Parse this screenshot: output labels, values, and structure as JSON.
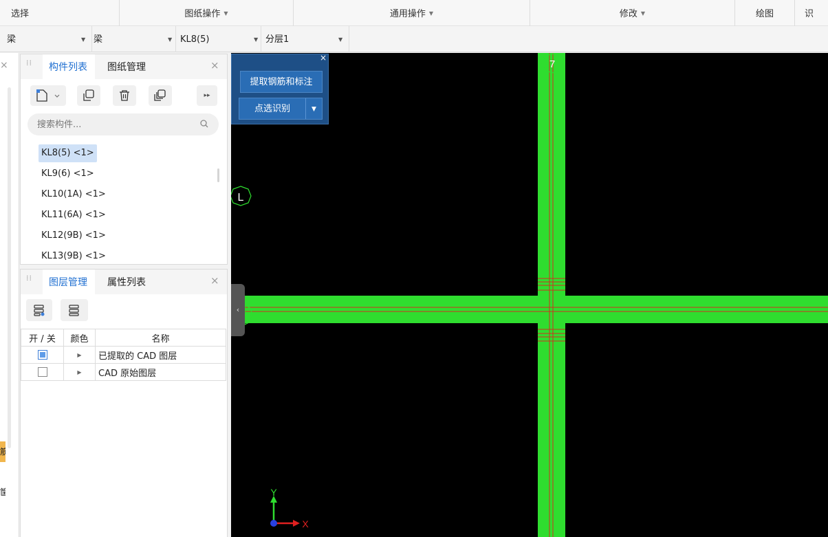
{
  "ribbon": {
    "groups": [
      {
        "label": "选择",
        "has_caret": false
      },
      {
        "label": "图纸操作",
        "has_caret": true
      },
      {
        "label": "通用操作",
        "has_caret": true
      },
      {
        "label": "修改",
        "has_caret": true
      },
      {
        "label": "绘图",
        "has_caret": false
      },
      {
        "label": "识",
        "has_caret": false
      }
    ]
  },
  "selector_bar": {
    "element_type": "梁",
    "element_subtype": "梁",
    "component": "KL8(5)",
    "layer": "分层1"
  },
  "component_panel": {
    "tabs": [
      "构件列表",
      "图纸管理"
    ],
    "active_tab": "构件列表",
    "search_placeholder": "搜索构件...",
    "items": [
      {
        "label": "KL8(5) <1>",
        "selected": true
      },
      {
        "label": "KL9(6) <1>",
        "selected": false
      },
      {
        "label": "KL10(1A) <1>",
        "selected": false
      },
      {
        "label": "KL11(6A) <1>",
        "selected": false
      },
      {
        "label": "KL12(9B) <1>",
        "selected": false
      },
      {
        "label": "KL13(9B) <1>",
        "selected": false
      }
    ]
  },
  "layer_panel": {
    "tabs": [
      "图层管理",
      "属性列表"
    ],
    "active_tab": "图层管理",
    "columns": [
      "开 / 关",
      "颜色",
      "名称"
    ],
    "rows": [
      {
        "checked": true,
        "name": "已提取的 CAD 图层"
      },
      {
        "checked": false,
        "name": "CAD 原始图层"
      }
    ]
  },
  "float_tool": {
    "extract_button": "提取钢筋和标注",
    "identify_button": "点选识别"
  },
  "canvas": {
    "axis_labels": {
      "grid_7": "7",
      "grid_L": "L"
    },
    "ucs": {
      "x": "X",
      "y": "Y"
    },
    "colors": {
      "beam": "#2fdd2f",
      "centerline": "#d0301f",
      "background": "#000000"
    }
  },
  "left_strip": {
    "snippet_1": "筋",
    "snippet_2": "筐"
  }
}
